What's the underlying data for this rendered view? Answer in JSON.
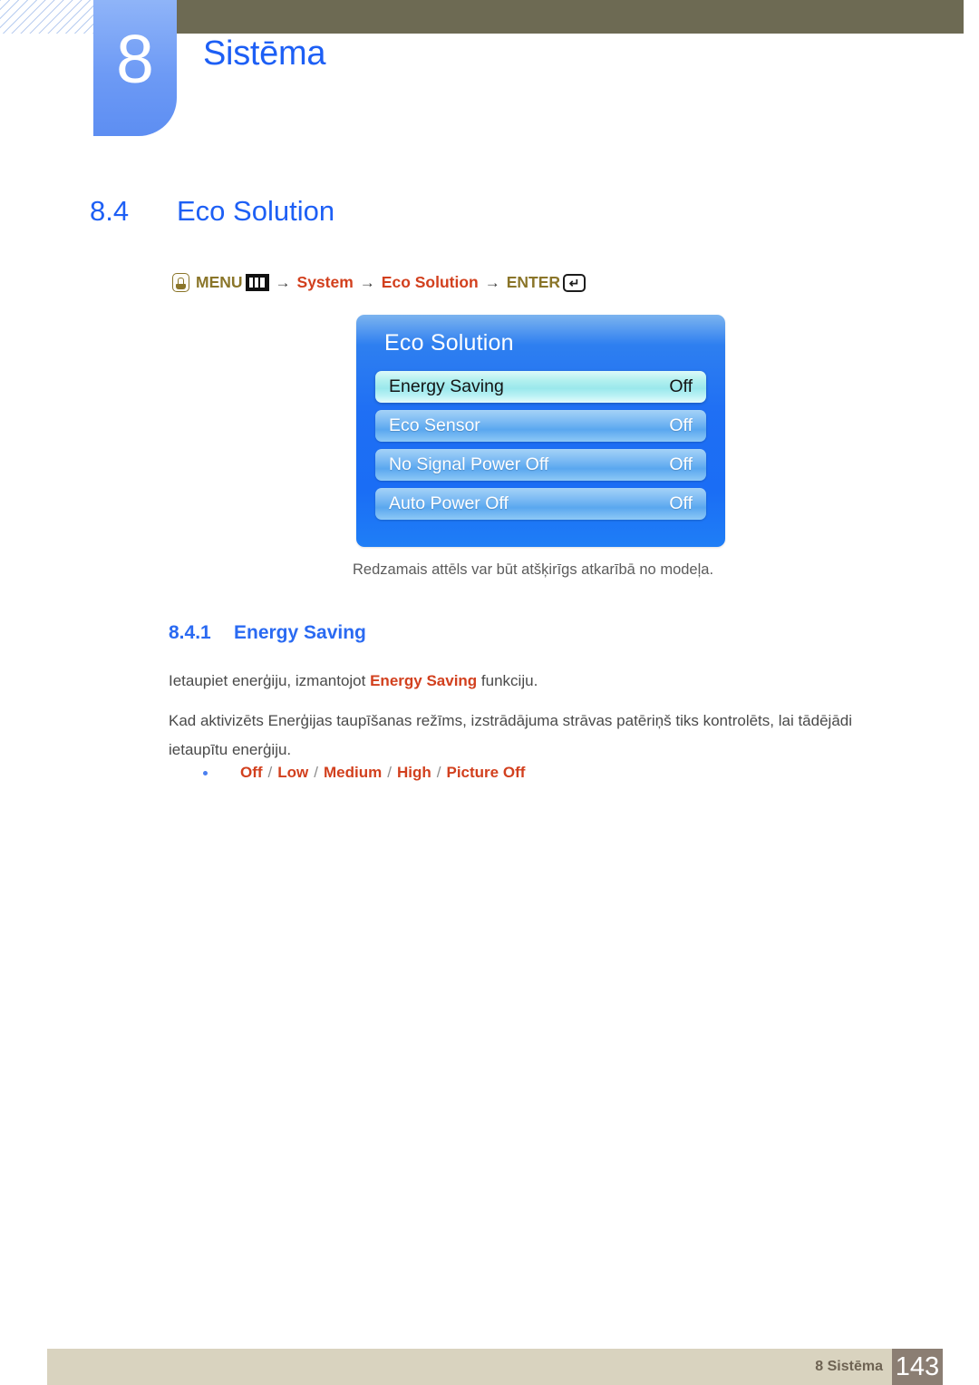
{
  "header": {
    "chapter_number": "8",
    "chapter_title": "Sistēma"
  },
  "section": {
    "number": "8.4",
    "title": "Eco Solution"
  },
  "menu_path": {
    "hand_icon": "hand-pointer-icon",
    "menu_label": "MENU",
    "menu_icon": "menu-bars-icon",
    "arrow1": "→",
    "step1": "System",
    "arrow2": "→",
    "step2": "Eco Solution",
    "arrow3": "→",
    "enter_label": "ENTER",
    "enter_icon": "enter-return-icon",
    "enter_glyph": "↵"
  },
  "osd": {
    "title": "Eco Solution",
    "rows": [
      {
        "label": "Energy Saving",
        "value": "Off",
        "selected": true
      },
      {
        "label": "Eco Sensor",
        "value": "Off",
        "selected": false
      },
      {
        "label": "No Signal Power Off",
        "value": "Off",
        "selected": false
      },
      {
        "label": "Auto Power Off",
        "value": "Off",
        "selected": false
      }
    ]
  },
  "figure_caption": "Redzamais attēls var būt atšķirīgs atkarībā no modeļa.",
  "subsection": {
    "number": "8.4.1",
    "title": "Energy Saving"
  },
  "paragraphs": {
    "p1_before": "Ietaupiet enerģiju, izmantojot ",
    "p1_keyword": "Energy Saving",
    "p1_after": " funkciju.",
    "p2": "Kad aktivizēts Enerģijas taupīšanas režīms, izstrādājuma strāvas patēriņš tiks kontrolēts, lai tādējādi ietaupītu enerģiju."
  },
  "options": {
    "items": [
      "Off",
      "Low",
      "Medium",
      "High",
      "Picture Off"
    ],
    "separator": "/"
  },
  "footer": {
    "label": "8 Sistēma",
    "page_number": "143"
  },
  "colors": {
    "accent_blue": "#1d5ff5",
    "keyword_orange": "#d2401e",
    "gold": "#8a7529",
    "olive_bar": "#6d6a53",
    "footer_bar": "#d9d3bf",
    "footer_box": "#8b7e73"
  }
}
